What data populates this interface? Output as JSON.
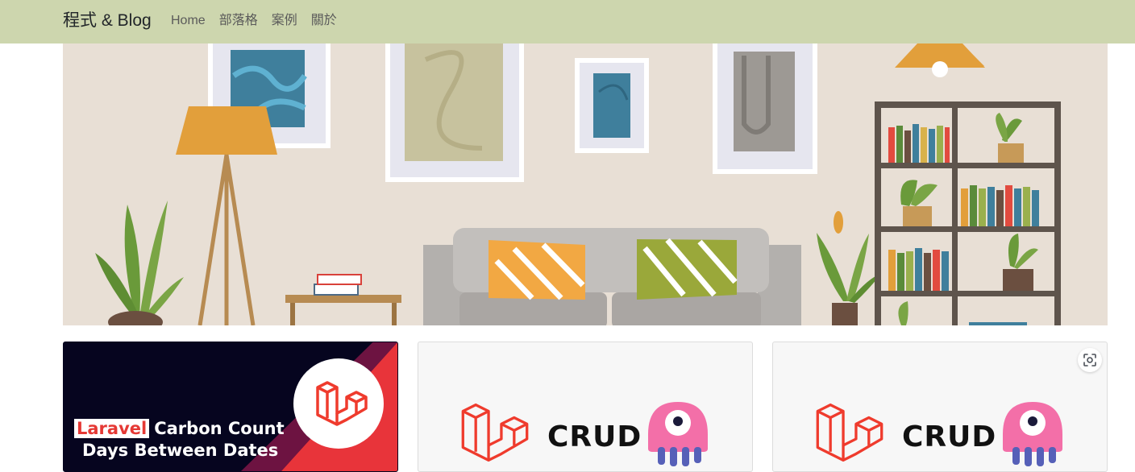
{
  "nav": {
    "brand": "程式 & Blog",
    "links": [
      "Home",
      "部落格",
      "案例",
      "關於"
    ]
  },
  "cards": [
    {
      "tag": "Laravel",
      "title_line1": "Carbon Count",
      "title_line2": "Days Between Dates"
    },
    {
      "badge": "CRUD"
    },
    {
      "badge": "CRUD"
    }
  ],
  "icons": {
    "lens": "image-search-icon",
    "logo": "laravel-logo",
    "mascot": "octopus-mascot"
  },
  "colors": {
    "navbar": "#cdd6ae",
    "hero_wall": "#e8dfd5",
    "laravel_red": "#ef3b2d",
    "mascot_pink": "#f36fa8"
  }
}
